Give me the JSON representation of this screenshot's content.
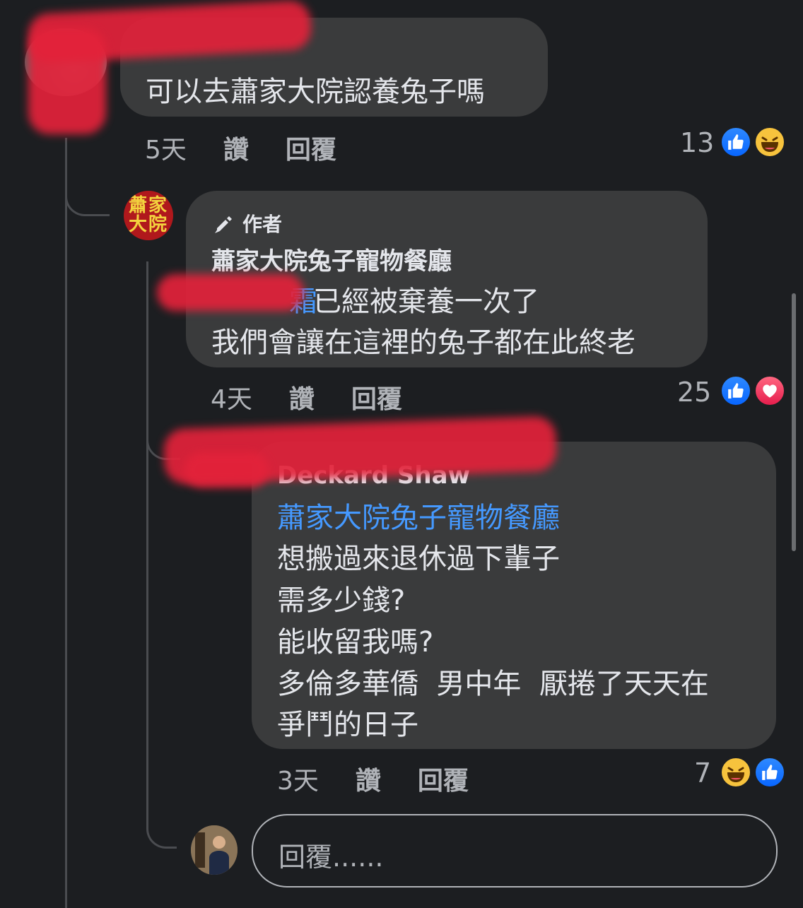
{
  "comments": [
    {
      "author": "",
      "text": "可以去蕭家大院認養兔子嗎",
      "time": "5天",
      "like_label": "讚",
      "reply_label": "回覆",
      "reaction_count": "13",
      "reactions": [
        "like",
        "haha"
      ]
    },
    {
      "author_badge": "作者",
      "author": "蕭家大院兔子寵物餐廳",
      "mention": "霜",
      "lines": [
        "已經被棄養一次了",
        "我們會讓在這裡的兔子都在此終老"
      ],
      "time": "4天",
      "like_label": "讚",
      "reply_label": "回覆",
      "reaction_count": "25",
      "reactions": [
        "like",
        "love"
      ],
      "avatar_text": [
        "蕭家",
        "大院"
      ]
    },
    {
      "author": "Deckard Shaw",
      "mention": "蕭家大院兔子寵物餐廳",
      "lines": [
        "想搬過來退休過下輩子",
        "需多少錢?",
        "能收留我嗎?",
        "多倫多華僑  男中年  厭捲了天天在",
        "爭鬥的日子"
      ],
      "time": "3天",
      "like_label": "讚",
      "reply_label": "回覆",
      "reaction_count": "7",
      "reactions": [
        "haha",
        "like"
      ]
    }
  ],
  "reply_box": {
    "placeholder": "回覆......"
  },
  "colors": {
    "background": "#1c1e21",
    "bubble": "#3a3b3c",
    "mention": "#4599ff",
    "redaction": "#e3223a"
  }
}
